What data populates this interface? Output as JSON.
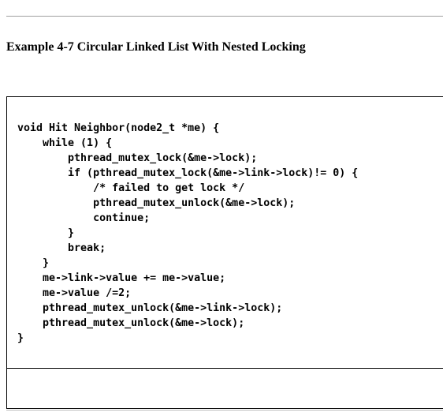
{
  "example": {
    "heading": "Example 4-7 Circular Linked List With Nested Locking"
  },
  "code": {
    "lines": [
      "void Hit Neighbor(node2_t *me) {",
      "    while (1) {",
      "        pthread_mutex_lock(&me->lock);",
      "        if (pthread_mutex_lock(&me->link->lock)!= 0) {",
      "            /* failed to get lock */",
      "            pthread_mutex_unlock(&me->lock);",
      "            continue;",
      "        }",
      "        break;",
      "    }",
      "    me->link->value += me->value;",
      "    me->value /=2;",
      "    pthread_mutex_unlock(&me->link->lock);",
      "    pthread_mutex_unlock(&me->lock);",
      "}"
    ]
  }
}
